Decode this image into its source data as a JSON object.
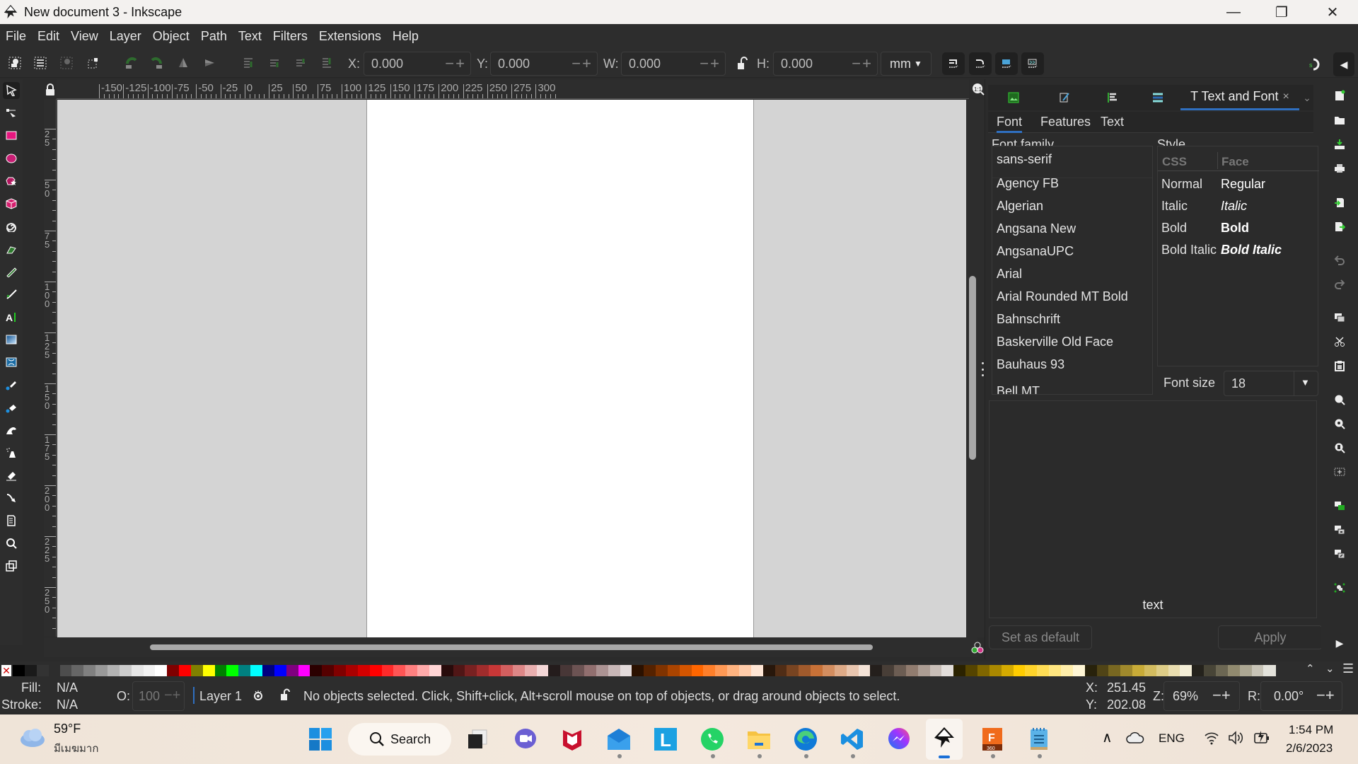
{
  "window": {
    "title": "New document 3 - Inkscape",
    "controls": {
      "minimize": "—",
      "maximize": "❐",
      "close": "✕"
    }
  },
  "menu": [
    "File",
    "Edit",
    "View",
    "Layer",
    "Object",
    "Path",
    "Text",
    "Filters",
    "Extensions",
    "Help"
  ],
  "toolbar": {
    "x_label": "X:",
    "x_value": "0.000",
    "y_label": "Y:",
    "y_value": "0.000",
    "w_label": "W:",
    "w_value": "0.000",
    "h_label": "H:",
    "h_value": "0.000",
    "unit": "mm",
    "pm": "−+",
    "icons": [
      "select-all-icon",
      "select-all-layers-icon",
      "deselect-icon",
      "select-same-icon",
      "rotate-ccw-icon",
      "rotate-cw-icon",
      "flip-horizontal-icon",
      "flip-vertical-icon",
      "raise-to-top-icon",
      "raise-icon",
      "lower-icon",
      "lower-to-bottom-icon"
    ],
    "transform_icons": [
      "scale-stroke-icon",
      "scale-corners-icon",
      "transform-gradients-icon",
      "transform-patterns-icon"
    ]
  },
  "tools": [
    "selector",
    "node",
    "rectangle",
    "ellipse",
    "star",
    "3d-box",
    "spiral",
    "pen",
    "pencil",
    "calligraphy",
    "text",
    "gradient",
    "mesh",
    "dropper",
    "paint-bucket",
    "tweak",
    "spray",
    "eraser",
    "connector",
    "pages",
    "zoom",
    "measure"
  ],
  "rulers": {
    "horizontal": [
      "-150",
      "-125",
      "-100",
      "-75",
      "-50",
      "-25",
      "0",
      "25",
      "50",
      "75",
      "100",
      "125",
      "150",
      "175",
      "200",
      "225",
      "250",
      "275",
      "300"
    ],
    "vertical": [
      "2 5",
      "5 0",
      "7 5",
      "1 0 0",
      "1 2 5",
      "1 5 0",
      "1 7 5",
      "2 0 0",
      "2 2 5",
      "2 5 0"
    ]
  },
  "dock": {
    "tabs": [
      {
        "icon": "export-icon"
      },
      {
        "icon": "fill-stroke-icon"
      },
      {
        "icon": "align-icon"
      },
      {
        "icon": "layers-icon"
      },
      {
        "label": "T Text and Font",
        "close": "×",
        "active": true
      }
    ],
    "subtabs": [
      "Font",
      "Features",
      "Text"
    ],
    "active_subtab": "Font",
    "font_family_label": "Font family",
    "style_label": "Style",
    "font_family_value": "sans-serif",
    "fonts": [
      "Agency FB",
      "Algerian",
      "Angsana New",
      "AngsanaUPC",
      "Arial",
      "Arial Rounded MT Bold",
      "Bahnschrift",
      "Baskerville Old Face",
      "Bauhaus 93",
      "Bell MT"
    ],
    "style_headers": {
      "css": "CSS",
      "face": "Face"
    },
    "styles": [
      {
        "css": "Normal",
        "face": "Regular"
      },
      {
        "css": "Italic",
        "face": "Italic"
      },
      {
        "css": "Bold",
        "face": "Bold"
      },
      {
        "css": "Bold Italic",
        "face": "Bold Italic"
      }
    ],
    "font_size_label": "Font size",
    "font_size": "18",
    "preview_text": "text",
    "set_default": "Set as default",
    "apply": "Apply"
  },
  "status": {
    "fill_label": "Fill:",
    "fill_value": "N/A",
    "stroke_label": "Stroke:",
    "stroke_value": "N/A",
    "opacity_label": "O:",
    "opacity_value": "100",
    "layer": "Layer 1",
    "message": "No objects selected. Click, Shift+click, Alt+scroll mouse on top of objects, or drag around objects to select.",
    "x_label": "X:",
    "x": "251.45",
    "y_label": "Y:",
    "y": "202.08",
    "zoom_label": "Z:",
    "zoom": "69%",
    "rotation_label": "R:",
    "rotation": "0.00°"
  },
  "palette": [
    "#000000",
    "#1a1a1a",
    "#333333",
    "#4d4d4d",
    "#666666",
    "#808080",
    "#999999",
    "#b3b3b3",
    "#cccccc",
    "#e6e6e6",
    "#f2f2f2",
    "#ffffff",
    "#800000",
    "#ff0000",
    "#808000",
    "#ffff00",
    "#008000",
    "#00ff00",
    "#008080",
    "#00ffff",
    "#000080",
    "#0000ff",
    "#800080",
    "#ff00ff",
    "#2b0000",
    "#550000",
    "#800000",
    "#aa0000",
    "#d40000",
    "#ff0000",
    "#ff2a2a",
    "#ff5555",
    "#ff8080",
    "#ffaaaa",
    "#ffd5d5",
    "#280b0b",
    "#501616",
    "#782121",
    "#a02c2c",
    "#c83737",
    "#d35f5f",
    "#de8787",
    "#e9afaf",
    "#f4d7d7",
    "#241c1c",
    "#483737",
    "#6c5353",
    "#916f6f",
    "#ac9393",
    "#c8b7b7",
    "#e3dbdb",
    "#2b1100",
    "#552200",
    "#803300",
    "#aa4400",
    "#d45500",
    "#ff6600",
    "#ff7f2a",
    "#ff9955",
    "#ffb380",
    "#ffccaa",
    "#ffe6d5",
    "#28170b",
    "#502d16",
    "#784421",
    "#a05a2c",
    "#c87137",
    "#d38d5f",
    "#deaa87",
    "#e9c6af",
    "#f4e3d7",
    "#241f1c",
    "#483e37",
    "#6c5d53",
    "#917c6f",
    "#ac9d93",
    "#c8beb7",
    "#e3dedb",
    "#2b2200",
    "#554400",
    "#806600",
    "#aa8800",
    "#d4aa00",
    "#ffcc00",
    "#ffd42a",
    "#ffdd55",
    "#ffe680",
    "#ffeeaa",
    "#fff6d5",
    "#28220b",
    "#504416",
    "#786721",
    "#a0892c",
    "#c8ab37",
    "#d3bc5f",
    "#decd87",
    "#e9ddaf",
    "#f4eed7",
    "#24221c",
    "#484537",
    "#6c6753",
    "#918a6f",
    "#aca793",
    "#c8c4b7",
    "#e3e2db"
  ],
  "taskbar": {
    "weather_temp": "59°F",
    "weather_desc": "มีเมฆมาก",
    "search": "Search",
    "apps": [
      "start",
      "search",
      "task-view",
      "teams-meet",
      "mcafee",
      "mail",
      "l-app",
      "whatsapp",
      "file-explorer",
      "edge",
      "vscode",
      "messenger",
      "inkscape",
      "fusion-360",
      "notepad"
    ],
    "lang": "ENG",
    "time": "1:54 PM",
    "date": "2/6/2023"
  }
}
